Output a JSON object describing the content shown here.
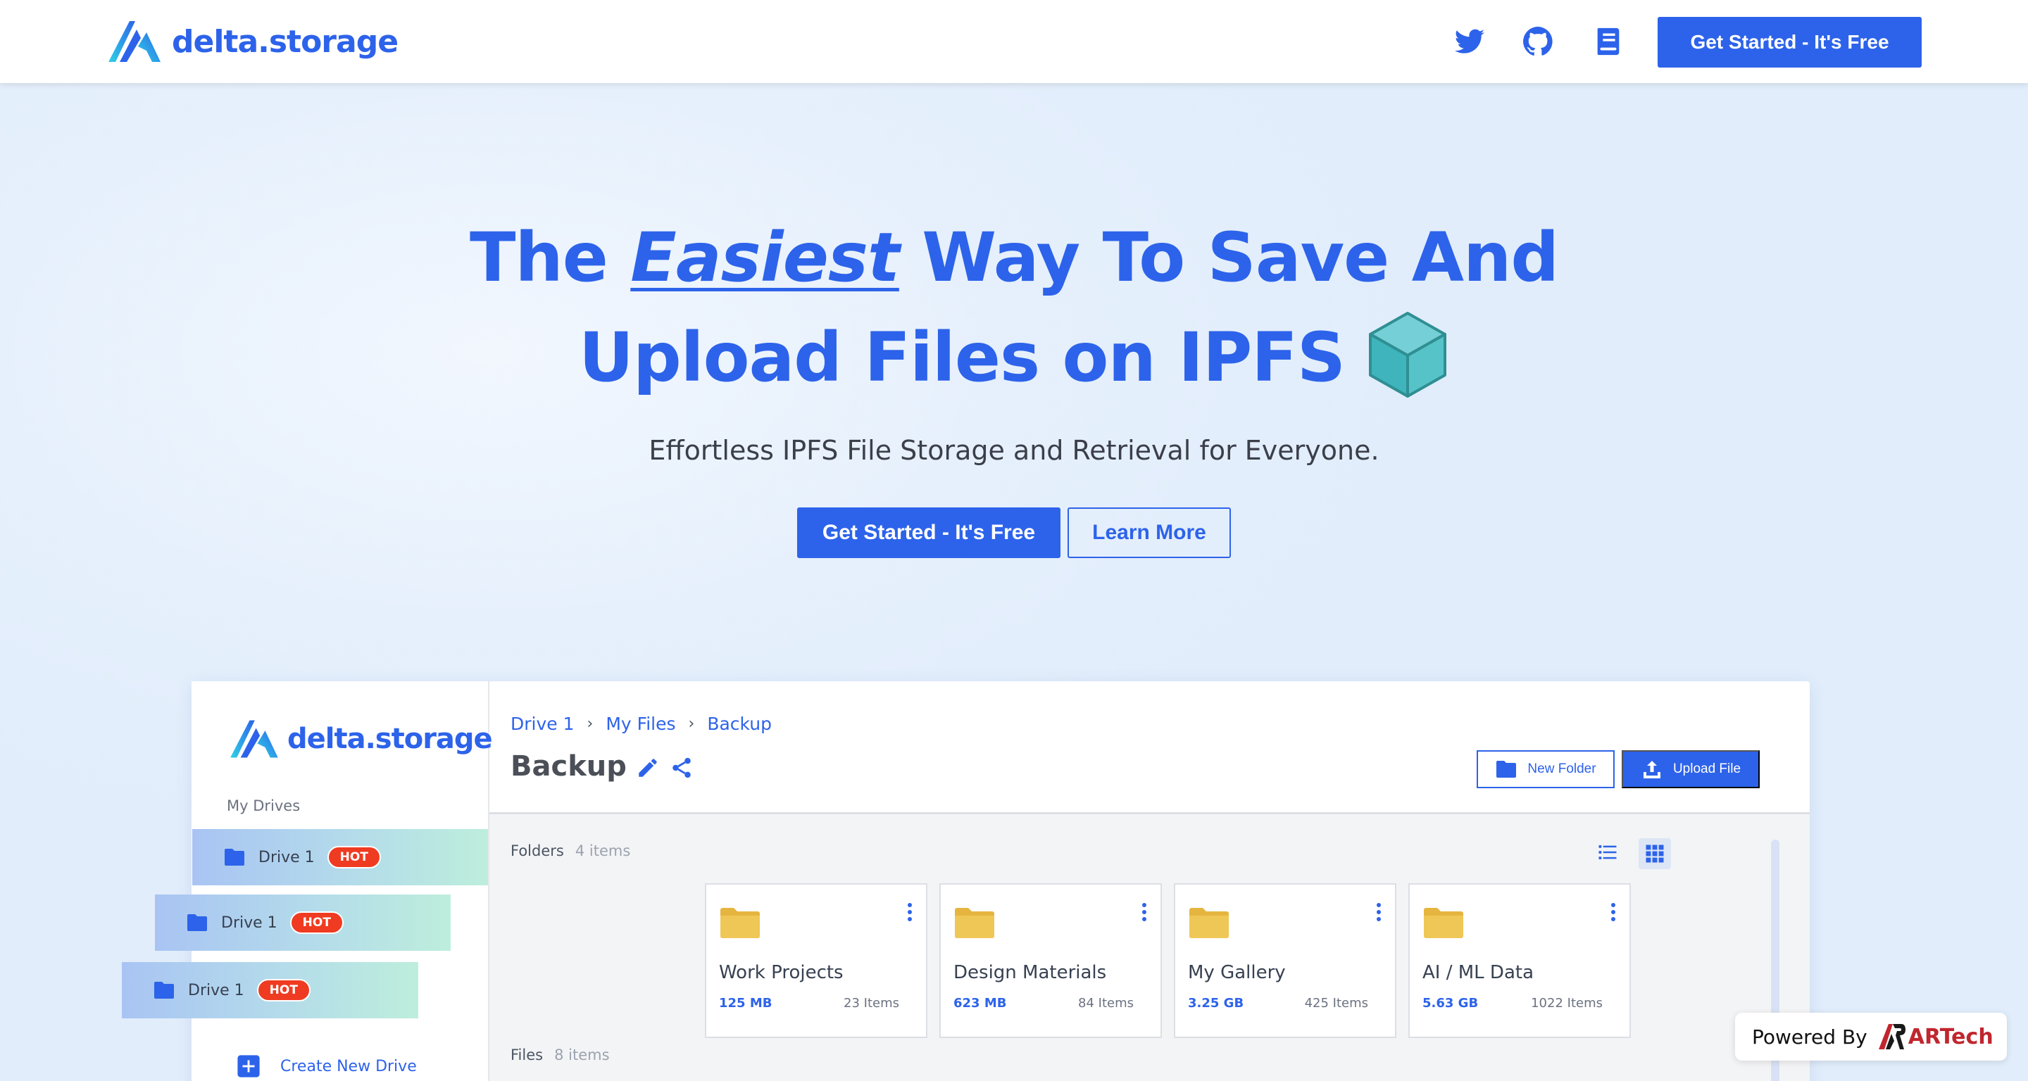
{
  "brand": {
    "name": "delta.storage"
  },
  "nav": {
    "cta_label": "Get Started - It's Free",
    "icons": [
      "twitter-icon",
      "github-icon",
      "docs-icon"
    ]
  },
  "hero": {
    "line1_before": "The ",
    "line1_em": "Easiest",
    "line1_after": " Way To Save And",
    "line2": "Upload Files on IPFS",
    "subtitle": "Effortless IPFS File Storage and Retrieval for Everyone.",
    "cta_primary": "Get Started - It's Free",
    "cta_secondary": "Learn More"
  },
  "app": {
    "sidebar": {
      "brand": "delta.storage",
      "section_label": "My Drives",
      "drives": [
        {
          "label": "Drive 1",
          "badge": "HOT"
        },
        {
          "label": "Drive 1",
          "badge": "HOT"
        },
        {
          "label": "Drive 1",
          "badge": "HOT"
        }
      ],
      "create_label": "Create New Drive"
    },
    "breadcrumb": [
      "Drive 1",
      "My Files",
      "Backup"
    ],
    "title": "Backup",
    "new_folder_label": "New Folder",
    "upload_label": "Upload File",
    "folders_label": "Folders",
    "folders_count": "4 items",
    "files_label": "Files",
    "files_count": "8 items",
    "folders": [
      {
        "name": "Work Projects",
        "size": "125 MB",
        "items": "23 Items"
      },
      {
        "name": "Design Materials",
        "size": "623 MB",
        "items": "84 Items"
      },
      {
        "name": "My Gallery",
        "size": "3.25 GB",
        "items": "425 Items"
      },
      {
        "name": "AI / ML Data",
        "size": "5.63 GB",
        "items": "1022 Items"
      }
    ]
  },
  "powered": {
    "prefix": "Powered By",
    "brand": "ARTech"
  },
  "colors": {
    "accent": "#2d63ea",
    "hot": "#ef3b21",
    "folder": "#e5b53f"
  }
}
